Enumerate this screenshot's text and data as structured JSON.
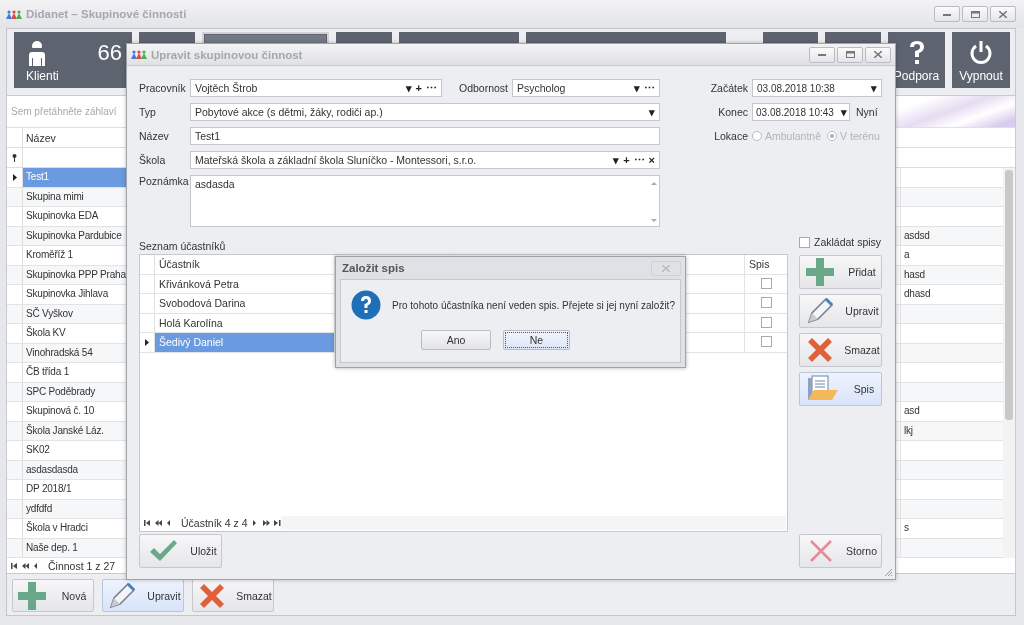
{
  "main_window": {
    "title": "Didanet – Skupinové činnosti",
    "tiles": [
      {
        "kind": "person",
        "label": "Klienti",
        "count": "66",
        "selected": false
      },
      {
        "kind": "blank",
        "selected": false
      },
      {
        "kind": "blank",
        "selected": true
      },
      {
        "kind": "blank",
        "selected": false
      },
      {
        "kind": "blank",
        "selected": false
      },
      {
        "kind": "blank",
        "selected": false
      },
      {
        "kind": "blank",
        "selected": false
      },
      {
        "kind": "blank",
        "selected": false
      },
      {
        "kind": "help",
        "label": "Podpora",
        "selected": false
      },
      {
        "kind": "power",
        "label": "Vypnout",
        "selected": false
      }
    ],
    "group_panel_hint": "Sem přetáhněte záhlaví",
    "grid": {
      "columns": [
        {
          "label": "Název"
        }
      ],
      "rows": [
        {
          "name": "Test1",
          "selected": true
        },
        {
          "name": "Skupina mimi",
          "selected": false
        },
        {
          "name": "Skupinovka EDA",
          "selected": false
        },
        {
          "name": "Skupinovka Pardubice",
          "column_2": "asdsd",
          "selected": false
        },
        {
          "name": "Kroměříž 1",
          "column_2": "a",
          "selected": false
        },
        {
          "name": "Skupinovka PPP Praha",
          "column_2": "hasd",
          "selected": false
        },
        {
          "name": "Skupinovka Jihlava",
          "column_2": "dhasd",
          "selected": false
        },
        {
          "name": "SČ Vyškov",
          "selected": false
        },
        {
          "name": "Škola KV",
          "selected": false
        },
        {
          "name": "Vinohradská 54",
          "selected": false
        },
        {
          "name": "ČB třída 1",
          "selected": false
        },
        {
          "name": "SPC Poděbrady",
          "selected": false
        },
        {
          "name": "Skupinová č. 10",
          "column_2": "asd",
          "selected": false
        },
        {
          "name": "Škola Janské Láz.",
          "column_2": "lkj",
          "selected": false
        },
        {
          "name": "SK02",
          "selected": false
        },
        {
          "name": "asdasdasda",
          "selected": false
        },
        {
          "name": "DP 2018/1",
          "selected": false
        },
        {
          "name": "ydfdfd",
          "selected": false
        },
        {
          "name": "Škola v Hradci",
          "column_2": "s",
          "selected": false
        },
        {
          "name": "Naše dep. 1",
          "selected": false
        }
      ],
      "navigator": "Činnost 1 z 27"
    },
    "buttons": [
      {
        "kind": "add",
        "label": "Nová",
        "highlighted": false
      },
      {
        "kind": "edit",
        "label": "Upravit",
        "highlighted": true
      },
      {
        "kind": "delete",
        "label": "Smazat",
        "highlighted": false
      }
    ]
  },
  "dialog": {
    "title": "Upravit skupinovou činnost",
    "worker": {
      "label": "Pracovník",
      "value": "Vojtěch Štrob",
      "editor_buttons": [
        "▾",
        "+",
        "⋯"
      ]
    },
    "specialty": {
      "label": "Odbornost",
      "value": "Psycholog",
      "editor_buttons": [
        "▾",
        "⋯"
      ]
    },
    "type": {
      "label": "Typ",
      "value": "Pobytové akce (s dětmi, žáky, rodiči ap.)",
      "editor_buttons": [
        "▾"
      ]
    },
    "name": {
      "label": "Název",
      "value": "Test1"
    },
    "school": {
      "label": "Škola",
      "value": "Mateřská škola a základní škola Sluníčko - Montessori, s.r.o.",
      "editor_buttons": [
        "▾",
        "+",
        "⋯",
        "×"
      ]
    },
    "note": {
      "label": "Poznámka",
      "value": "asdasda"
    },
    "start": {
      "label": "Začátek",
      "value": "03.08.2018 10:38",
      "editor_buttons": [
        "▾"
      ]
    },
    "end": {
      "label": "Konec",
      "value": "03.08.2018 10:43",
      "editor_buttons": [
        "▾"
      ],
      "now_button": "Nyní"
    },
    "location": {
      "label": "Lokace",
      "disabled": true,
      "options": [
        {
          "label": "Ambulantně",
          "selected": false
        },
        {
          "label": "V terénu",
          "selected": true
        }
      ]
    },
    "participants": {
      "label": "Seznam účastníků",
      "columns": [
        {
          "label": "Účastník"
        },
        {
          "label": "Spis"
        }
      ],
      "rows": [
        {
          "name": "Křivánková Petra",
          "spis": false,
          "selected": false
        },
        {
          "name": "Svobodová Darina",
          "spis": false,
          "selected": false
        },
        {
          "name": "Holá Karolína",
          "spis": false,
          "selected": false
        },
        {
          "name": "Šedivý Daniel",
          "spis": false,
          "selected": true
        }
      ],
      "navigator": "Účastník 4 z 4"
    },
    "create_files": {
      "label": "Zakládat spisy",
      "checked": false
    },
    "side_buttons": [
      {
        "kind": "add",
        "label": "Přidat",
        "highlighted": false
      },
      {
        "kind": "edit",
        "label": "Upravit",
        "highlighted": false
      },
      {
        "kind": "delete",
        "label": "Smazat",
        "highlighted": false
      },
      {
        "kind": "file",
        "label": "Spis",
        "highlighted": true
      }
    ],
    "save_button": {
      "kind": "save",
      "label": "Uložit"
    },
    "cancel_button": {
      "kind": "cancel",
      "label": "Storno"
    }
  },
  "message_box": {
    "title": "Založit spis",
    "text": "Pro tohoto účastníka není veden spis. Přejete si jej nyní založit?",
    "buttons": [
      {
        "label": "Ano",
        "focused": false
      },
      {
        "label": "Ne",
        "focused": true
      }
    ]
  }
}
